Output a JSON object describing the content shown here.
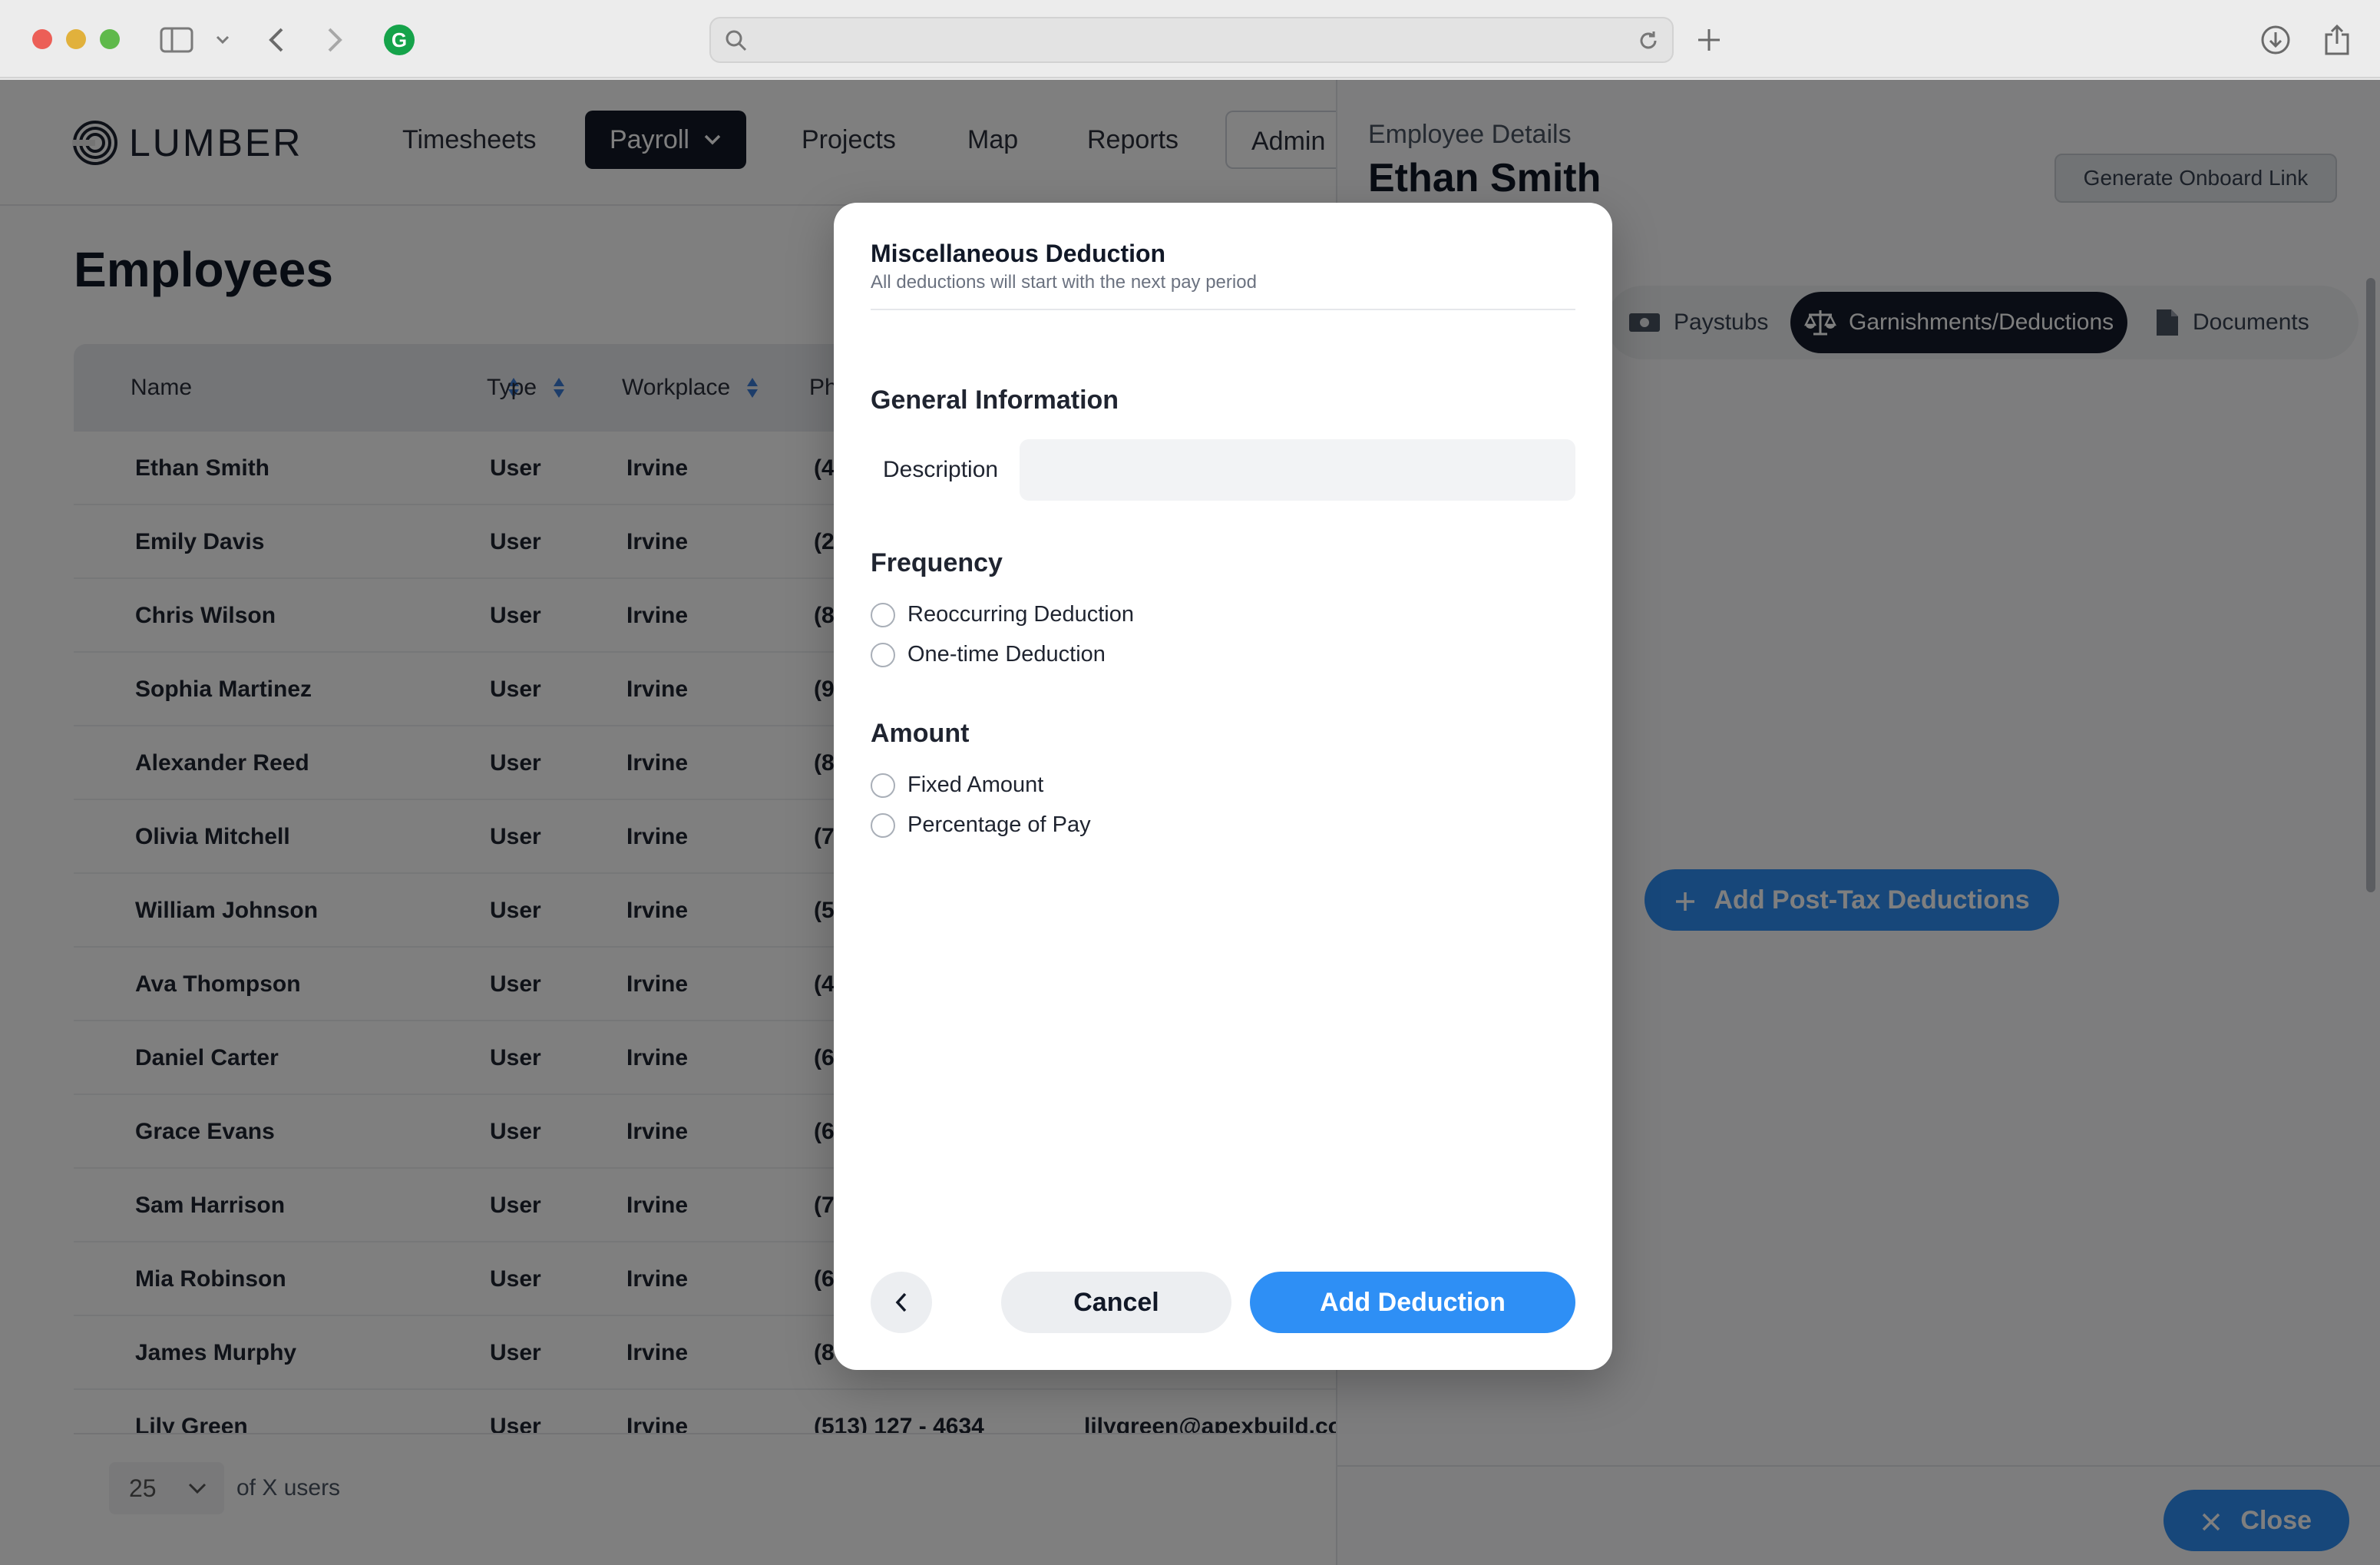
{
  "colors": {
    "accent": "#2e8ff5",
    "dark_nav": "#121826",
    "sort_arrow": "#3a7bd5"
  },
  "browser": {
    "url_placeholder": ""
  },
  "app": {
    "logo_text": "LUMBER",
    "nav": [
      "Timesheets",
      "Payroll",
      "Projects",
      "Map",
      "Reports",
      "Admin"
    ]
  },
  "page": {
    "title": "Employees"
  },
  "table": {
    "columns": [
      "Name",
      "Type",
      "Workplace",
      "Ph"
    ],
    "rows": [
      {
        "name": "Ethan Smith",
        "type": "User",
        "workplace": "Irvine",
        "phone": "(4"
      },
      {
        "name": "Emily Davis",
        "type": "User",
        "workplace": "Irvine",
        "phone": "(2"
      },
      {
        "name": "Chris Wilson",
        "type": "User",
        "workplace": "Irvine",
        "phone": "(8"
      },
      {
        "name": "Sophia Martinez",
        "type": "User",
        "workplace": "Irvine",
        "phone": "(9"
      },
      {
        "name": "Alexander Reed",
        "type": "User",
        "workplace": "Irvine",
        "phone": "(8"
      },
      {
        "name": "Olivia Mitchell",
        "type": "User",
        "workplace": "Irvine",
        "phone": "(7"
      },
      {
        "name": "William Johnson",
        "type": "User",
        "workplace": "Irvine",
        "phone": "(5"
      },
      {
        "name": "Ava Thompson",
        "type": "User",
        "workplace": "Irvine",
        "phone": "(4"
      },
      {
        "name": "Daniel Carter",
        "type": "User",
        "workplace": "Irvine",
        "phone": "(6"
      },
      {
        "name": "Grace Evans",
        "type": "User",
        "workplace": "Irvine",
        "phone": "(6"
      },
      {
        "name": "Sam Harrison",
        "type": "User",
        "workplace": "Irvine",
        "phone": "(7"
      },
      {
        "name": "Mia Robinson",
        "type": "User",
        "workplace": "Irvine",
        "phone": "(6"
      },
      {
        "name": "James Murphy",
        "type": "User",
        "workplace": "Irvine",
        "phone": "(8"
      },
      {
        "name": "Lily Green",
        "type": "User",
        "workplace": "Irvine",
        "phone": "(513) 127 - 4634",
        "email": "lilygreen@apexbuild.co"
      }
    ],
    "per_page": "25",
    "of_users": "of X users"
  },
  "panel": {
    "subtitle": "Employee Details",
    "name": "Ethan Smith",
    "onboard_label": "Generate Onboard Link",
    "tabs": [
      "Paystubs",
      "Garnishments/Deductions",
      "Documents"
    ],
    "add_post_tax_label": "Add Post-Tax Deductions",
    "close_label": "Close"
  },
  "modal": {
    "title": "Miscellaneous Deduction",
    "subtitle": "All deductions will start with the next pay period",
    "general_heading": "General Information",
    "description_label": "Description",
    "description_value": "",
    "frequency_heading": "Frequency",
    "frequency_options": [
      "Reoccurring Deduction",
      "One-time Deduction"
    ],
    "amount_heading": "Amount",
    "amount_options": [
      "Fixed Amount",
      "Percentage of Pay"
    ],
    "cancel_label": "Cancel",
    "add_label": "Add Deduction"
  }
}
